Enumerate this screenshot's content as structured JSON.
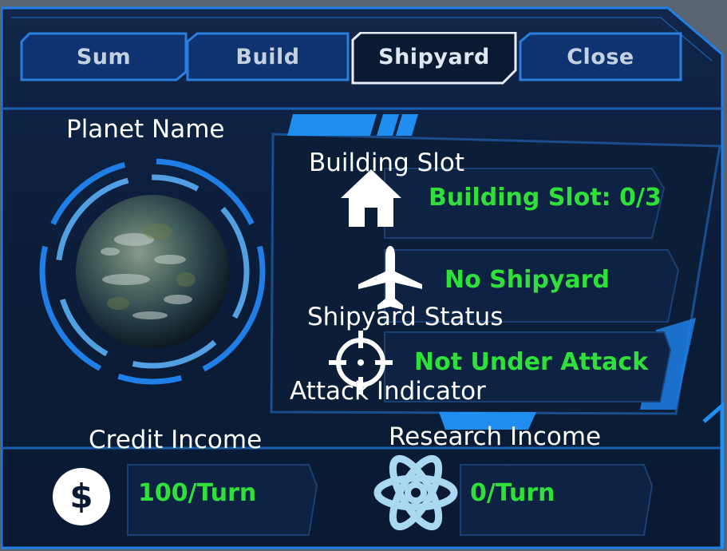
{
  "tabs": [
    {
      "label": "Sum"
    },
    {
      "label": "Build"
    },
    {
      "label": "Shipyard"
    },
    {
      "label": "Close"
    }
  ],
  "overlay_labels": {
    "planet_name": "Planet Name",
    "building_slot": "Building Slot",
    "shipyard_status": "Shipyard Status",
    "attack_indicator": "Attack Indicator",
    "credit_income": "Credit Income",
    "research_income": "Research Income"
  },
  "status": {
    "building_slot": "Building Slot: 0/3",
    "shipyard": "No Shipyard",
    "attack": "Not Under Attack"
  },
  "income": {
    "credit": "100/Turn",
    "research": "0/Turn",
    "credit_symbol": "$"
  },
  "icons": {
    "building": "house-icon",
    "shipyard": "airplane-icon",
    "attack": "crosshair-icon",
    "credit": "dollar-coin-icon",
    "research": "atom-icon"
  },
  "colors": {
    "status_green": "#2fe03a",
    "frame_blue": "#1f7fe6",
    "panel_dark": "#0c1d3a"
  }
}
